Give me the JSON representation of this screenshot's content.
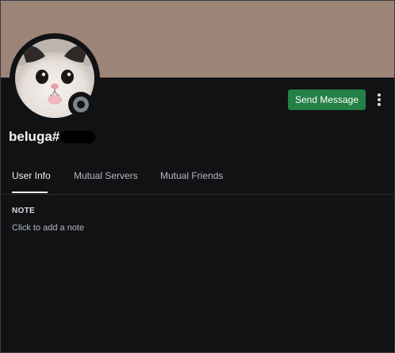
{
  "profile": {
    "username": "beluga#",
    "status": "offline",
    "banner_color": "#9c8477",
    "avatar_description": "cat photo avatar"
  },
  "actions": {
    "send_message_label": "Send Message",
    "more_icon": "more-vertical-icon"
  },
  "tabs": [
    {
      "label": "User Info",
      "active": true
    },
    {
      "label": "Mutual Servers",
      "active": false
    },
    {
      "label": "Mutual Friends",
      "active": false
    }
  ],
  "note": {
    "heading": "NOTE",
    "placeholder": "Click to add a note"
  },
  "colors": {
    "background": "#111214",
    "accent_green": "#248046",
    "status_offline": "#80848e"
  }
}
